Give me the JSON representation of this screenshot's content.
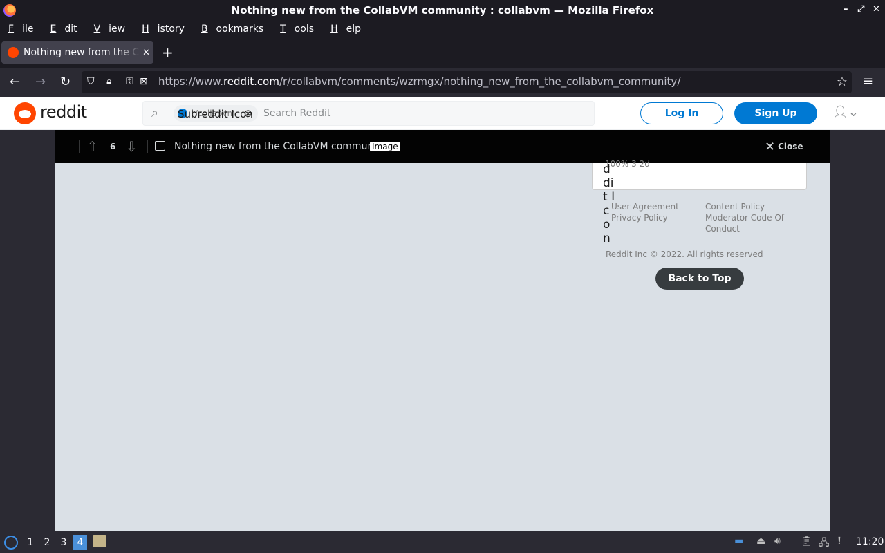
{
  "window": {
    "title": "Nothing new from the CollabVM community : collabvm — Mozilla Firefox",
    "controls": [
      "–",
      "⤢",
      "✕"
    ]
  },
  "menu": {
    "items": [
      {
        "ul": "F",
        "rest": "ile"
      },
      {
        "ul": "E",
        "rest": "dit"
      },
      {
        "ul": "V",
        "rest": "iew"
      },
      {
        "ul": "H",
        "rest": "istory"
      },
      {
        "ul": "B",
        "rest": "ookmarks"
      },
      {
        "ul": "T",
        "rest": "ools"
      },
      {
        "ul": "H",
        "rest": "elp"
      }
    ]
  },
  "tabs": [
    {
      "title": "Nothing new from the CollabVM community : collabvm",
      "close": "✕"
    }
  ],
  "newtab": "+",
  "nav": {
    "back": "←",
    "forward": "→",
    "reload": "↻",
    "url_prefix": "https://www.",
    "url_domain": "reddit.com",
    "url_path": "/r/collabvm/comments/wzrmgx/nothing_new_from_the_collabvm_community/",
    "star": "☆",
    "menu": "≡"
  },
  "reddit": {
    "logo_text": "reddit",
    "search": {
      "chip_alt": "Subreddit Icon",
      "chip_name": "r/collabvm",
      "placeholder": "Search Reddit"
    },
    "login": "Log In",
    "signup": "Sign Up"
  },
  "postbar": {
    "score": "6",
    "title": "Nothing new from the CollabVM community",
    "flair": "Image",
    "close": "Close"
  },
  "sidebar": {
    "stats": "100%   3   2d",
    "broken_alt": "ddit Icon"
  },
  "footer": {
    "links_left": [
      "User Agreement",
      "Privacy Policy"
    ],
    "links_right": [
      "Content Policy",
      "Moderator Code Of",
      "Conduct"
    ],
    "copyright": "Reddit Inc © 2022. All rights reserved",
    "back_to_top": "Back to Top"
  },
  "taskbar": {
    "workspaces": [
      "1",
      "2",
      "3",
      "4"
    ],
    "active_workspace": "4",
    "clock": "11:20"
  }
}
